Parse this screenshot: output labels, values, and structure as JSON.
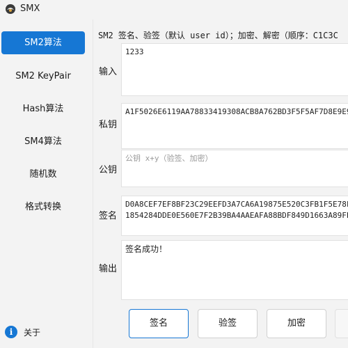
{
  "window": {
    "title": "SMX"
  },
  "sidebar": {
    "items": [
      {
        "label": "SM2算法",
        "active": true
      },
      {
        "label": "SM2 KeyPair",
        "active": false
      },
      {
        "label": "Hash算法",
        "active": false
      },
      {
        "label": "SM4算法",
        "active": false
      },
      {
        "label": "随机数",
        "active": false
      },
      {
        "label": "格式转换",
        "active": false
      }
    ],
    "about": {
      "label": "关于",
      "icon": "info-icon"
    }
  },
  "main": {
    "description": "SM2 签名、验签（默认 user id）；加密、解密（顺序：C1C3C",
    "input": {
      "label": "输入",
      "value": "1233"
    },
    "private_key": {
      "label": "私钥",
      "value": "A1F5026E6119AA78833419308ACB8A762BD3F5F5AF7D8E9E9"
    },
    "public_key": {
      "label": "公钥",
      "placeholder": "公钥 x+y（验签、加密）"
    },
    "signature": {
      "label": "签名",
      "line1": "D0A8CEF7EF8BF23C29EEFD3A7CA6A19875E520C3FB1F5E78F",
      "line2": "1854284DDE0E560E7F2B39BA4AAEAFA88BDF849D1663A89FE"
    },
    "output": {
      "label": "输出",
      "value": "签名成功！"
    },
    "buttons": {
      "sign": "签名",
      "verify": "验签",
      "encrypt": "加密",
      "decrypt": ""
    }
  },
  "colors": {
    "accent": "#1677d4",
    "background": "#f3f3f3"
  }
}
